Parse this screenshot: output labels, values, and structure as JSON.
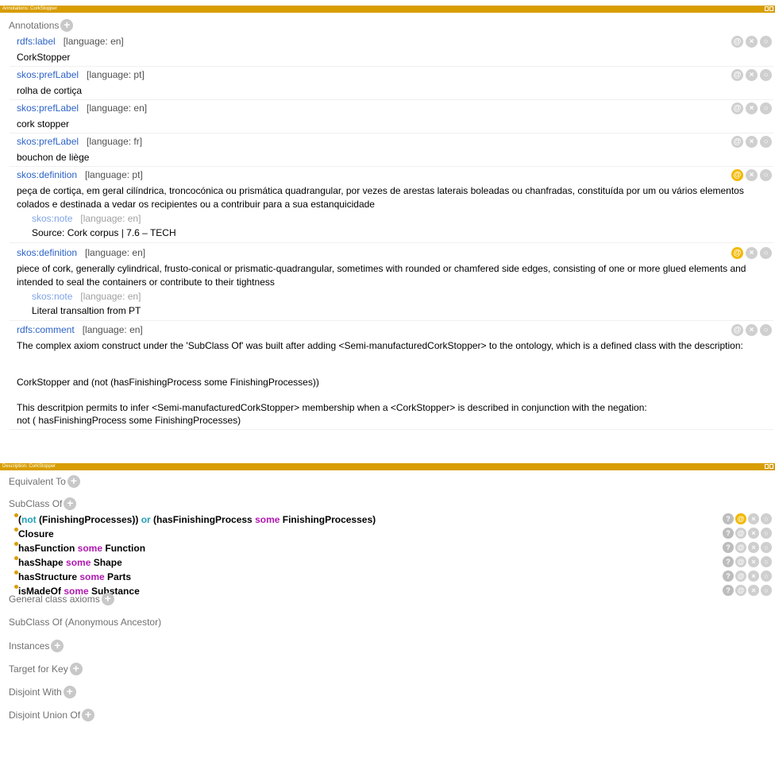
{
  "annotations_panel": {
    "title": "Annotations: CorkStopper",
    "section": "Annotations",
    "items": [
      {
        "property": "rdfs:label",
        "lang": "[language: en]",
        "value": "CorkStopper"
      },
      {
        "property": "skos:prefLabel",
        "lang": "[language: pt]",
        "value": "rolha de cortiça"
      },
      {
        "property": "skos:prefLabel",
        "lang": "[language: en]",
        "value": "cork stopper"
      },
      {
        "property": "skos:prefLabel",
        "lang": "[language: fr]",
        "value": "bouchon de liège"
      },
      {
        "property": "skos:definition",
        "lang": "[language: pt]",
        "value": "peça de cortiça, em geral cilíndrica, troncocónica ou prismática quadrangular, por vezes de arestas laterais boleadas ou chanfradas, constituída por um ou vários elementos colados e destinada a vedar os recipientes ou a contribuir para a sua estanquicidade",
        "note_property": "skos:note",
        "note_lang": "[language: en]",
        "note_value": "Source: Cork corpus | 7.6 – TECH"
      },
      {
        "property": "skos:definition",
        "lang": "[language: en]",
        "value": "piece of cork, generally cylindrical, frusto-conical or prismatic-quadrangular, sometimes with rounded or chamfered side edges, consisting of one or more glued elements and intended to seal the containers or contribute to their tightness",
        "note_property": "skos:note",
        "note_lang": "[language: en]",
        "note_value": "Literal transaltion from PT"
      },
      {
        "property": "rdfs:comment",
        "lang": "[language: en]",
        "value_lines": [
          "The complex axiom construct under the 'SubClass Of' was built after adding <Semi-manufacturedCorkStopper> to the ontology, which is a defined class with the description:",
          "",
          "CorkStopper and (not (hasFinishingProcess some FinishingProcesses))",
          "",
          "This descritpion permits to infer  <Semi-manufacturedCorkStopper> membership when a <CorkStopper> is described in conjunction with the  negation:",
          "not ( hasFinishingProcess some FinishingProcesses)"
        ]
      }
    ]
  },
  "description_panel": {
    "title": "Description: CorkStopper",
    "sections": {
      "equivalent_to": "Equivalent To",
      "subclass_of": "SubClass Of",
      "general_class_axioms": "General class axioms",
      "subclass_of_anon": "SubClass Of (Anonymous Ancestor)",
      "instances": "Instances",
      "target_for_key": "Target for Key",
      "disjoint_with": "Disjoint With",
      "disjoint_union_of": "Disjoint Union Of"
    },
    "axioms": [
      {
        "parts": [
          [
            "(",
            "n"
          ],
          [
            "not",
            "c"
          ],
          [
            " (FinishingProcesses)) ",
            "n"
          ],
          [
            "or",
            "c"
          ],
          [
            " (hasFinishingProcess ",
            "n"
          ],
          [
            "some",
            "k"
          ],
          [
            " FinishingProcesses)",
            "n"
          ]
        ]
      },
      {
        "parts": [
          [
            "Closure",
            "n"
          ]
        ]
      },
      {
        "parts": [
          [
            "hasFunction ",
            "n"
          ],
          [
            "some",
            "k"
          ],
          [
            " Function",
            "n"
          ]
        ]
      },
      {
        "parts": [
          [
            "hasShape ",
            "n"
          ],
          [
            "some",
            "k"
          ],
          [
            " Shape",
            "n"
          ]
        ]
      },
      {
        "parts": [
          [
            "hasStructure ",
            "n"
          ],
          [
            "some",
            "k"
          ],
          [
            " Parts",
            "n"
          ]
        ]
      },
      {
        "parts": [
          [
            "isMadeOf ",
            "n"
          ],
          [
            "some",
            "k"
          ],
          [
            " Substance",
            "n"
          ]
        ]
      }
    ]
  },
  "icons": {
    "annotate": "@",
    "delete": "×",
    "edit": "○",
    "explain": "?"
  },
  "colors": {
    "accent": "#d89d00",
    "highlight": "#f3b800",
    "property": "#2d63c7",
    "keyword": "#b018b0",
    "connective": "#20a0b8"
  }
}
